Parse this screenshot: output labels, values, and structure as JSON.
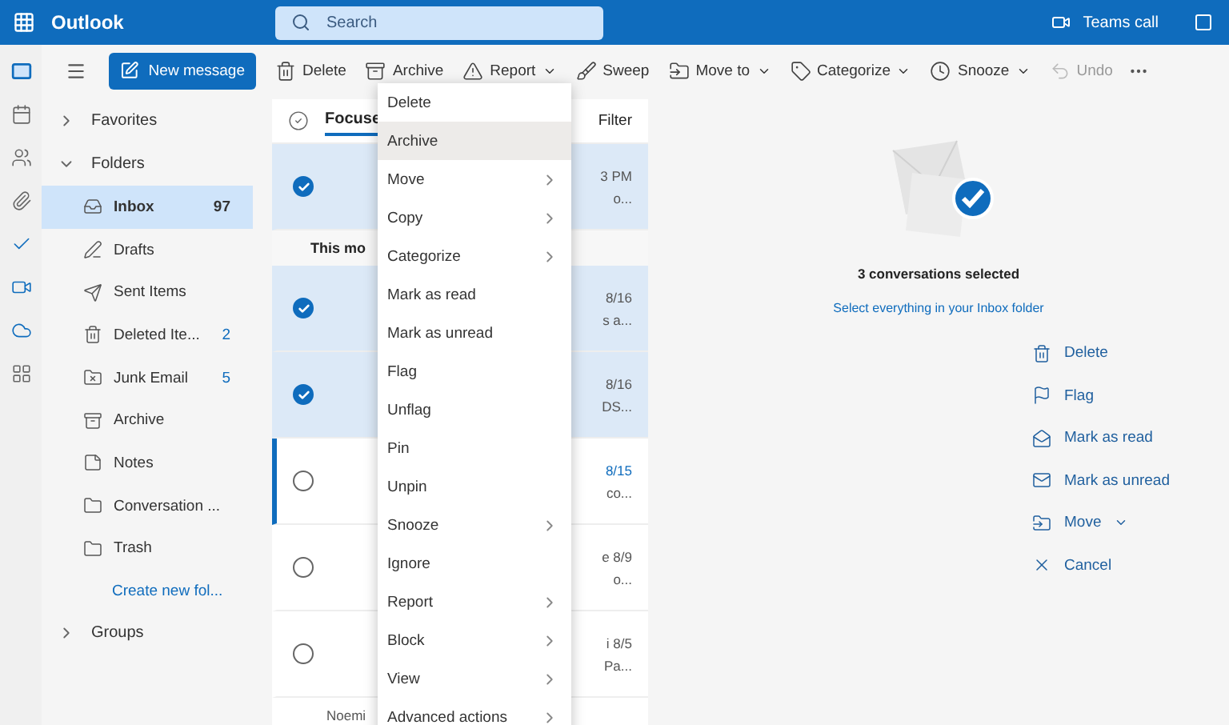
{
  "app": {
    "title": "Outlook",
    "search_placeholder": "Search",
    "teams_call": "Teams call"
  },
  "rail": [
    {
      "selected": true
    },
    {
      "selected": false
    },
    {
      "selected": false
    },
    {
      "selected": false
    },
    {
      "selected": false
    },
    {
      "selected": false
    },
    {
      "selected": false
    },
    {
      "selected": false
    }
  ],
  "new_message": "New message",
  "toolbar": [
    {
      "label": "Delete",
      "dropdown": false,
      "disabled": false
    },
    {
      "label": "Archive",
      "dropdown": false,
      "disabled": false
    },
    {
      "label": "Report",
      "dropdown": true,
      "disabled": false
    },
    {
      "label": "Sweep",
      "dropdown": false,
      "disabled": false
    },
    {
      "label": "Move to",
      "dropdown": true,
      "disabled": false
    },
    {
      "label": "Categorize",
      "dropdown": true,
      "disabled": false
    },
    {
      "label": "Snooze",
      "dropdown": true,
      "disabled": false
    },
    {
      "label": "Undo",
      "dropdown": false,
      "disabled": true
    }
  ],
  "sections": [
    {
      "label": "Favorites",
      "expanded": false
    },
    {
      "label": "Folders",
      "expanded": true
    }
  ],
  "folders": [
    {
      "label": "Inbox",
      "count": "97",
      "selected": true
    },
    {
      "label": "Drafts",
      "selected": false
    },
    {
      "label": "Sent Items",
      "selected": false
    },
    {
      "label": "Deleted Ite...",
      "count": "2",
      "selected": false
    },
    {
      "label": "Junk Email",
      "count": "5",
      "selected": false
    },
    {
      "label": "Archive",
      "selected": false
    },
    {
      "label": "Notes",
      "selected": false
    },
    {
      "label": "Conversation ...",
      "selected": false
    },
    {
      "label": "Trash",
      "selected": false
    }
  ],
  "create_folder": "Create new fol...",
  "groups": {
    "label": "Groups",
    "expanded": false
  },
  "list": {
    "tab": "Focuse",
    "filter": "Filter",
    "group_header": "This mo",
    "footer": "Noemi",
    "rows": [
      {
        "selected": true,
        "unread": false,
        "time": "3 PM",
        "preview": "o..."
      },
      {
        "kind": "header"
      },
      {
        "selected": true,
        "unread": false,
        "time": "8/16",
        "preview": "s a..."
      },
      {
        "selected": true,
        "unread": false,
        "time": "8/16",
        "preview": "DS..."
      },
      {
        "selected": false,
        "unread": true,
        "time": "8/15",
        "preview": "co..."
      },
      {
        "selected": false,
        "unread": false,
        "time": "e 8/9",
        "preview": "o..."
      },
      {
        "selected": false,
        "unread": false,
        "time": "i 8/5",
        "preview": "Pa..."
      }
    ]
  },
  "context_menu": [
    {
      "label": "Delete",
      "submenu": false,
      "selected": false
    },
    {
      "label": "Archive",
      "submenu": false,
      "selected": true
    },
    {
      "label": "Move",
      "submenu": true,
      "selected": false
    },
    {
      "label": "Copy",
      "submenu": true,
      "selected": false
    },
    {
      "label": "Categorize",
      "submenu": true,
      "selected": false
    },
    {
      "label": "Mark as read",
      "submenu": false,
      "selected": false
    },
    {
      "label": "Mark as unread",
      "submenu": false,
      "selected": false
    },
    {
      "label": "Flag",
      "submenu": false,
      "selected": false
    },
    {
      "label": "Unflag",
      "submenu": false,
      "selected": false
    },
    {
      "label": "Pin",
      "submenu": false,
      "selected": false
    },
    {
      "label": "Unpin",
      "submenu": false,
      "selected": false
    },
    {
      "label": "Snooze",
      "submenu": true,
      "selected": false
    },
    {
      "label": "Ignore",
      "submenu": false,
      "selected": false
    },
    {
      "label": "Report",
      "submenu": true,
      "selected": false
    },
    {
      "label": "Block",
      "submenu": true,
      "selected": false
    },
    {
      "label": "View",
      "submenu": true,
      "selected": false
    },
    {
      "label": "Advanced actions",
      "submenu": true,
      "selected": false
    }
  ],
  "reading": {
    "title": "3 conversations selected",
    "select_all": "Select everything in your Inbox folder",
    "actions": [
      {
        "label": "Delete",
        "dropdown": false
      },
      {
        "label": "Flag",
        "dropdown": false
      },
      {
        "label": "Mark as read",
        "dropdown": false
      },
      {
        "label": "Mark as unread",
        "dropdown": false
      },
      {
        "label": "Move",
        "dropdown": true
      },
      {
        "label": "Cancel",
        "dropdown": false
      }
    ]
  }
}
